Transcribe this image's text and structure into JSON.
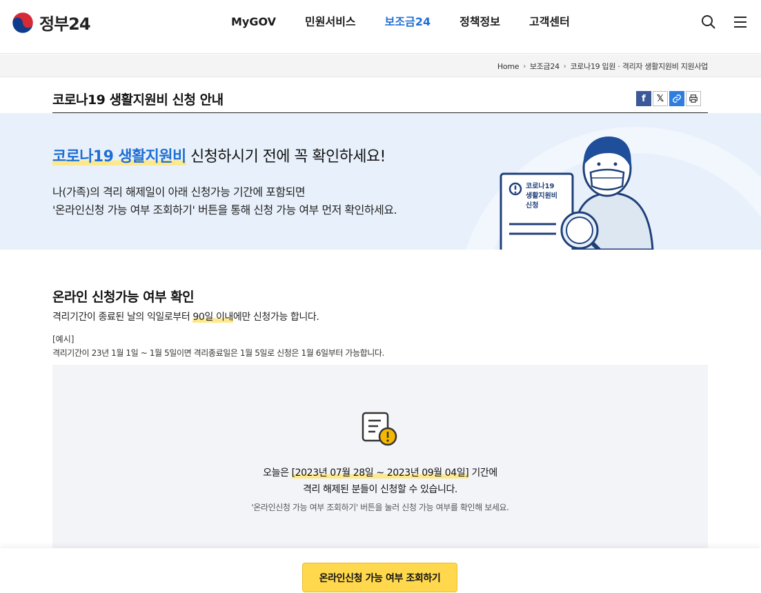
{
  "header": {
    "logo_text": "정부24",
    "nav": [
      "MyGOV",
      "민원서비스",
      "보조금24",
      "정책정보",
      "고객센터"
    ],
    "active_nav_index": 2,
    "icons": [
      "search-icon",
      "menu-icon"
    ]
  },
  "breadcrumb": [
    "Home",
    "보조금24",
    "코로나19 입원 · 격리자 생활지원비 지원사업"
  ],
  "page": {
    "title": "코로나19 생활지원비 신청 안내",
    "share_icons": [
      "facebook-icon",
      "x-icon",
      "link-icon",
      "print-icon"
    ]
  },
  "banner": {
    "headline_highlight": "코로나19 생활지원비",
    "headline_rest": " 신청하시기 전에 꼭 확인하세요!",
    "desc_line1": "나(가족)의 격리 해제일이 아래 신청가능 기간에 포함되면",
    "desc_line2": "'온라인신청 가능 여부 조회하기' 버튼을 통해 신청 가능 여부 먼저 확인하세요.",
    "card_text": [
      "코로나19",
      "생활지원비",
      "신청"
    ]
  },
  "section": {
    "title": "온라인 신청가능 여부 확인",
    "sub_before": "격리기간이 종료된 날의 익일로부터 ",
    "sub_highlight": "90일 이내",
    "sub_after": "에만 신청가능 합니다.",
    "example_label": "[예시]",
    "example_text": "격리기간이 23년 1월 1일 ~ 1월 5일이면 격리종료일은 1월 5일로 신청은 1월 6일부터 가능합니다."
  },
  "info": {
    "line1_before": "오늘은 ",
    "line1_highlight": "[2023년 07월 28일 ~ 2023년 09월 04일]",
    "line1_after": " 기간에",
    "line2": "격리 해제된 분들이 신청할 수 있습니다.",
    "line3": "'온라인신청 가능 여부 조회하기' 버튼을 눌러 신청 가능 여부를 확인해 보세요."
  },
  "cta": {
    "label": "온라인신청 가능 여부 조회하기"
  },
  "colors": {
    "accent": "#1f6ed4",
    "banner_bg": "#e8f1fb",
    "highlight": "#fde98c",
    "cta": "#ffd84d"
  }
}
